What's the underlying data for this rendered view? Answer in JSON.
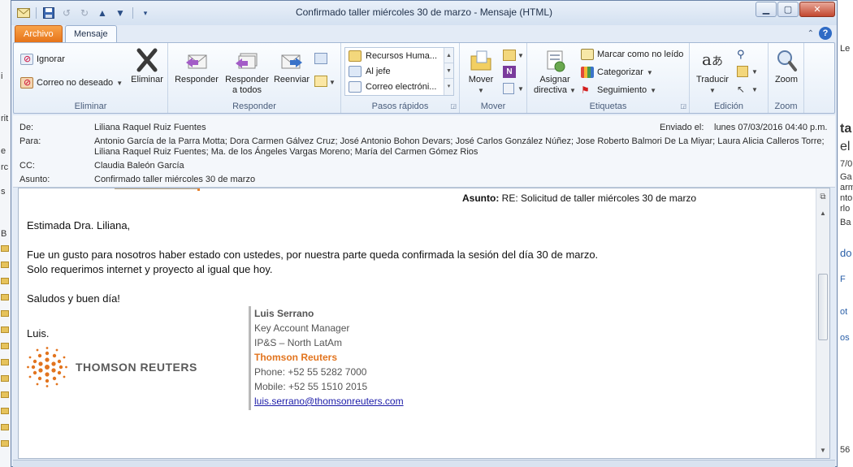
{
  "window": {
    "title": "Confirmado taller miércoles  30 de marzo  -  Mensaje (HTML)"
  },
  "tabs": {
    "archivo": "Archivo",
    "mensaje": "Mensaje"
  },
  "ribbon": {
    "eliminar": {
      "label": "Eliminar",
      "ignorar": "Ignorar",
      "correo_no_deseado": "Correo no deseado",
      "eliminar_btn": "Eliminar"
    },
    "responder": {
      "label": "Responder",
      "responder": "Responder",
      "responder_todos_1": "Responder",
      "responder_todos_2": "a todos",
      "reenviar": "Reenviar"
    },
    "pasos_rapidos": {
      "label": "Pasos rápidos",
      "items": [
        "Recursos Huma...",
        "Al jefe",
        "Correo electróni..."
      ]
    },
    "mover": {
      "label": "Mover",
      "mover": "Mover"
    },
    "etiquetas": {
      "label": "Etiquetas",
      "asignar_1": "Asignar",
      "asignar_2": "directiva",
      "marcar": "Marcar como no leído",
      "categorizar": "Categorizar",
      "seguimiento": "Seguimiento"
    },
    "edicion": {
      "label": "Edición",
      "traducir": "Traducir"
    },
    "zoom": {
      "label": "Zoom",
      "zoom": "Zoom"
    }
  },
  "header": {
    "de_label": "De:",
    "de": "Liliana Raquel Ruiz Fuentes",
    "enviado_label": "Enviado el:",
    "enviado": "lunes 07/03/2016 04:40 p.m.",
    "para_label": "Para:",
    "para_1": "Antonio García de la Parra Motta; Dora Carmen Gálvez Cruz; José Antonio Bohon Devars; José Carlos González Núñez; Jose Roberto Balmori De La Miyar; Laura Alicia Calleros Torre;",
    "para_2": "Liliana Raquel Ruiz Fuentes; Ma. de los Ángeles Vargas Moreno; María del Carmen Gómez Rios",
    "cc_label": "CC:",
    "cc": "Claudia Baleón García",
    "asunto_label": "Asunto:",
    "asunto": "Confirmado taller miércoles  30 de marzo"
  },
  "body": {
    "quoted_asunto_label": "Asunto:",
    "quoted_asunto": "RE: Solicitud de taller miércoles 30 de marzo",
    "greeting": "Estimada Dra. Liliana,",
    "line1": "Fue un gusto para nosotros haber estado con ustedes, por nuestra parte queda confirmada la sesión del día 30 de marzo.",
    "line2": "Solo requerimos internet y proyecto al igual que hoy.",
    "closing": "Saludos y buen día!",
    "signoff": "Luis."
  },
  "signature": {
    "name": "Luis Serrano",
    "role": "Key Account Manager",
    "division": "IP&S – North LatAm",
    "company": "Thomson Reuters",
    "phone": "Phone: +52 55 5282 7000",
    "mobile": "Mobile: +52 55 1510 2015",
    "email": "luis.serrano@thomsonreuters.com"
  },
  "logo": {
    "wordmark": "THOMSON REUTERS"
  },
  "background_right": [
    "Le",
    "ta",
    "el",
    "7/0",
    "Ga",
    "arm",
    "nto",
    "rlo",
    "Ba",
    "do",
    "F",
    "ot",
    "os",
    "56"
  ],
  "background_left": [
    "i",
    "rit",
    "e",
    "rc",
    "s",
    "B"
  ],
  "colors": {
    "accent_orange": "#e2741e",
    "link_blue": "#1b1ba8",
    "ribbon_blue": "#2f6bc5"
  }
}
